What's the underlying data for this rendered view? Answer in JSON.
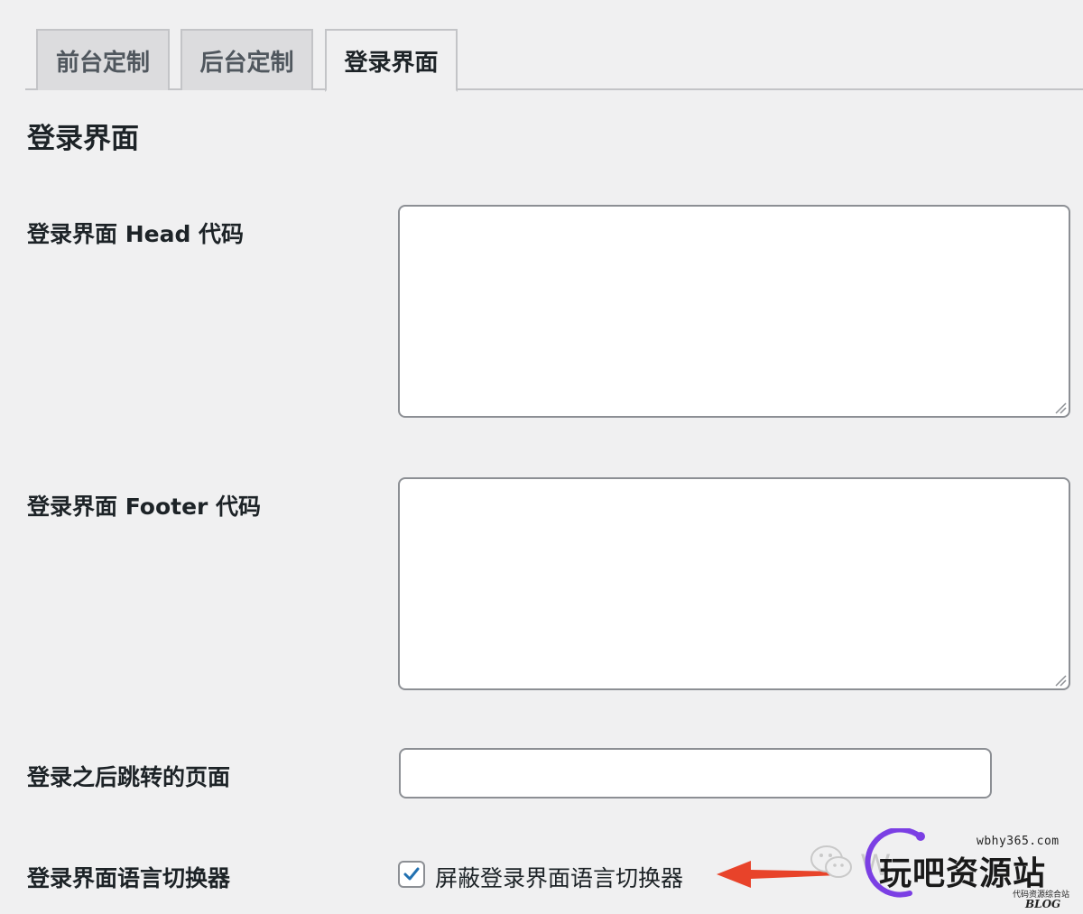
{
  "tabs": [
    {
      "label": "前台定制",
      "active": false
    },
    {
      "label": "后台定制",
      "active": false
    },
    {
      "label": "登录界面",
      "active": true
    }
  ],
  "section": {
    "title": "登录界面"
  },
  "fields": {
    "head_code": {
      "label": "登录界面 Head 代码",
      "value": ""
    },
    "footer_code": {
      "label": "登录界面 Footer 代码",
      "value": ""
    },
    "redirect_page": {
      "label": "登录之后跳转的页面",
      "value": ""
    },
    "language_switcher": {
      "label": "登录界面语言切换器",
      "checkbox_label": "屏蔽登录界面语言切换器",
      "checked": true
    }
  },
  "watermark": {
    "url": "wbhy365.com",
    "title": "玩吧资源站",
    "subtitle": "代码资源综合站",
    "blog": "BLOG",
    "letter": "W"
  },
  "colors": {
    "accent": "#2271b1",
    "arrow": "#e8432a",
    "ring": "#7b3fe4"
  }
}
